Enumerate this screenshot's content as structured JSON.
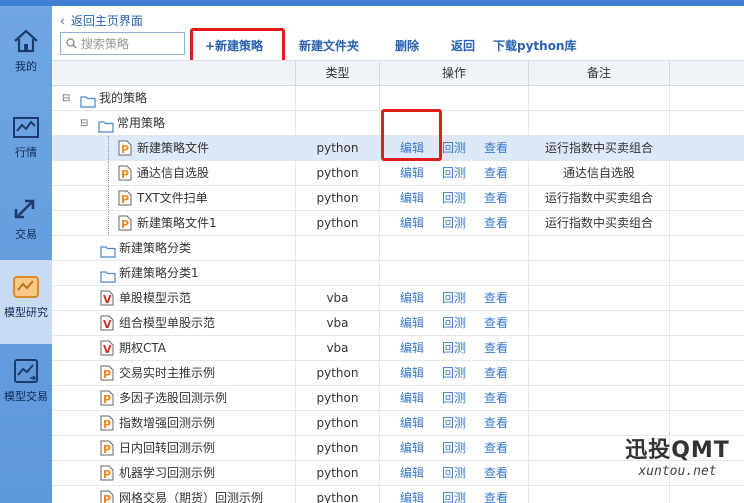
{
  "sidebar": {
    "items": [
      {
        "label": "我的",
        "icon": "home-icon"
      },
      {
        "label": "行情",
        "icon": "chart-line-icon"
      },
      {
        "label": "交易",
        "icon": "swap-arrows-icon"
      },
      {
        "label": "模型研究",
        "icon": "model-research-icon",
        "active": true
      },
      {
        "label": "模型交易",
        "icon": "model-trade-icon"
      }
    ]
  },
  "back_link": "返回主页界面",
  "search": {
    "placeholder": "搜索策略"
  },
  "toolbar": {
    "new_strategy": "+新建策略",
    "new_folder": "新建文件夹",
    "delete": "删除",
    "back": "返回",
    "download": "下载python库"
  },
  "columns": {
    "type": "类型",
    "operation": "操作",
    "note": "备注"
  },
  "ops_labels": {
    "edit": "编辑",
    "backtest": "回测",
    "view": "查看"
  },
  "rows": [
    {
      "name": "我的策略",
      "level": 0,
      "kind": "folder",
      "expander": "⊟",
      "type": "",
      "ops": false,
      "note": ""
    },
    {
      "name": "常用策略",
      "level": 1,
      "kind": "folder",
      "expander": "⊟",
      "type": "",
      "ops": false,
      "note": ""
    },
    {
      "name": "新建策略文件",
      "level": 2,
      "kind": "python",
      "type": "python",
      "ops": true,
      "note": "运行指数中买卖组合",
      "selected": true
    },
    {
      "name": "通达信自选股",
      "level": 2,
      "kind": "python",
      "type": "python",
      "ops": true,
      "note": "通达信自选股"
    },
    {
      "name": "TXT文件扫单",
      "level": 2,
      "kind": "python",
      "type": "python",
      "ops": true,
      "note": "运行指数中买卖组合"
    },
    {
      "name": "新建策略文件1",
      "level": 2,
      "kind": "python",
      "type": "python",
      "ops": true,
      "note": "运行指数中买卖组合"
    },
    {
      "name": "新建策略分类",
      "level": 1,
      "kind": "folder",
      "type": "",
      "ops": false,
      "note": ""
    },
    {
      "name": "新建策略分类1",
      "level": 1,
      "kind": "folder",
      "type": "",
      "ops": false,
      "note": ""
    },
    {
      "name": "单股模型示范",
      "level": 1,
      "kind": "vba",
      "type": "vba",
      "ops": true,
      "note": ""
    },
    {
      "name": "组合模型单股示范",
      "level": 1,
      "kind": "vba",
      "type": "vba",
      "ops": true,
      "note": ""
    },
    {
      "name": "期权CTA",
      "level": 1,
      "kind": "vba",
      "type": "vba",
      "ops": true,
      "note": ""
    },
    {
      "name": "交易实时主推示例",
      "level": 1,
      "kind": "python",
      "type": "python",
      "ops": true,
      "note": ""
    },
    {
      "name": "多因子选股回测示例",
      "level": 1,
      "kind": "python",
      "type": "python",
      "ops": true,
      "note": ""
    },
    {
      "name": "指数增强回测示例",
      "level": 1,
      "kind": "python",
      "type": "python",
      "ops": true,
      "note": ""
    },
    {
      "name": "日内回转回测示例",
      "level": 1,
      "kind": "python",
      "type": "python",
      "ops": true,
      "note": ""
    },
    {
      "name": "机器学习回测示例",
      "level": 1,
      "kind": "python",
      "type": "python",
      "ops": true,
      "note": ""
    },
    {
      "name": "网格交易（期货）回测示例",
      "level": 1,
      "kind": "python",
      "type": "python",
      "ops": true,
      "note": ""
    }
  ],
  "watermark": {
    "line1": "迅投QMT",
    "line2": "xuntou.net"
  },
  "colors": {
    "accent": "#2a62b0",
    "highlight": "#e21b1b",
    "sidebar": "#6fa6e3",
    "link": "#3a78cf"
  }
}
